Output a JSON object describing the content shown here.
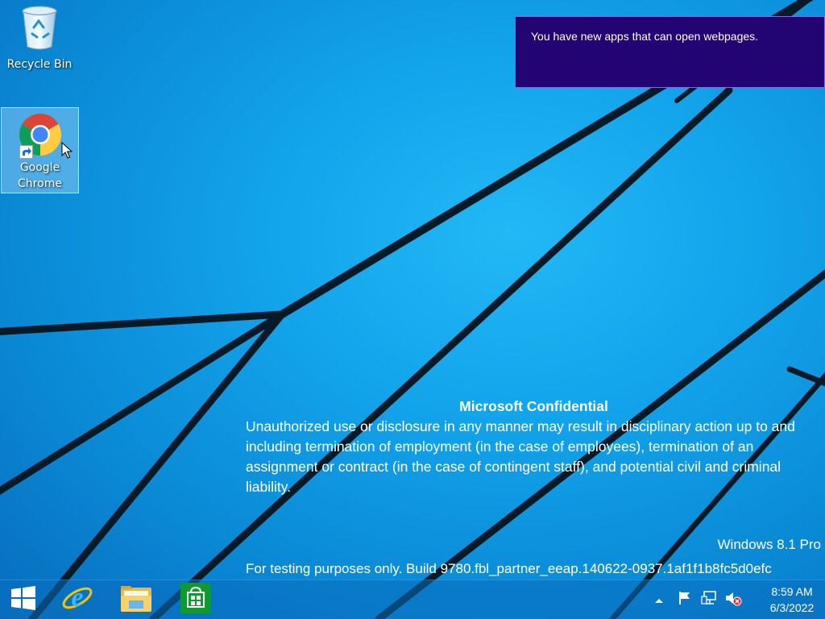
{
  "desktop": {
    "icons": [
      {
        "label": "Recycle Bin",
        "icon": "recycle-bin-icon"
      },
      {
        "label": "Google\nChrome",
        "icon": "chrome-icon",
        "selected": true
      }
    ]
  },
  "notification": {
    "text": "You have new apps that can open webpages."
  },
  "watermark": {
    "title": "Microsoft Confidential",
    "body": "Unauthorized use or disclosure in any manner may result in disciplinary action up to and including termination of employment (in the case of employees), termination of an assignment or contract (in the case of contingent staff), and potential civil and criminal liability.",
    "edition": "Windows 8.1 Pro",
    "build": "For testing purposes only. Build 9780.fbl_partner_eeap.140622-0937.1af1f1b8fc5d0efc"
  },
  "taskbar": {
    "pinned": [
      {
        "name": "start",
        "icon": "windows-logo-icon"
      },
      {
        "name": "internet-explorer",
        "icon": "internet-explorer-icon"
      },
      {
        "name": "file-explorer",
        "icon": "folder-icon"
      },
      {
        "name": "store",
        "icon": "store-icon"
      }
    ],
    "tray": {
      "icons": [
        "chevron-up-icon",
        "flag-icon",
        "network-icon",
        "speaker-muted-icon"
      ],
      "time": "8:59 AM",
      "date": "6/3/2022"
    }
  },
  "colors": {
    "notification_bg": "#220572",
    "wallpaper_blue": "#12a3ea"
  }
}
